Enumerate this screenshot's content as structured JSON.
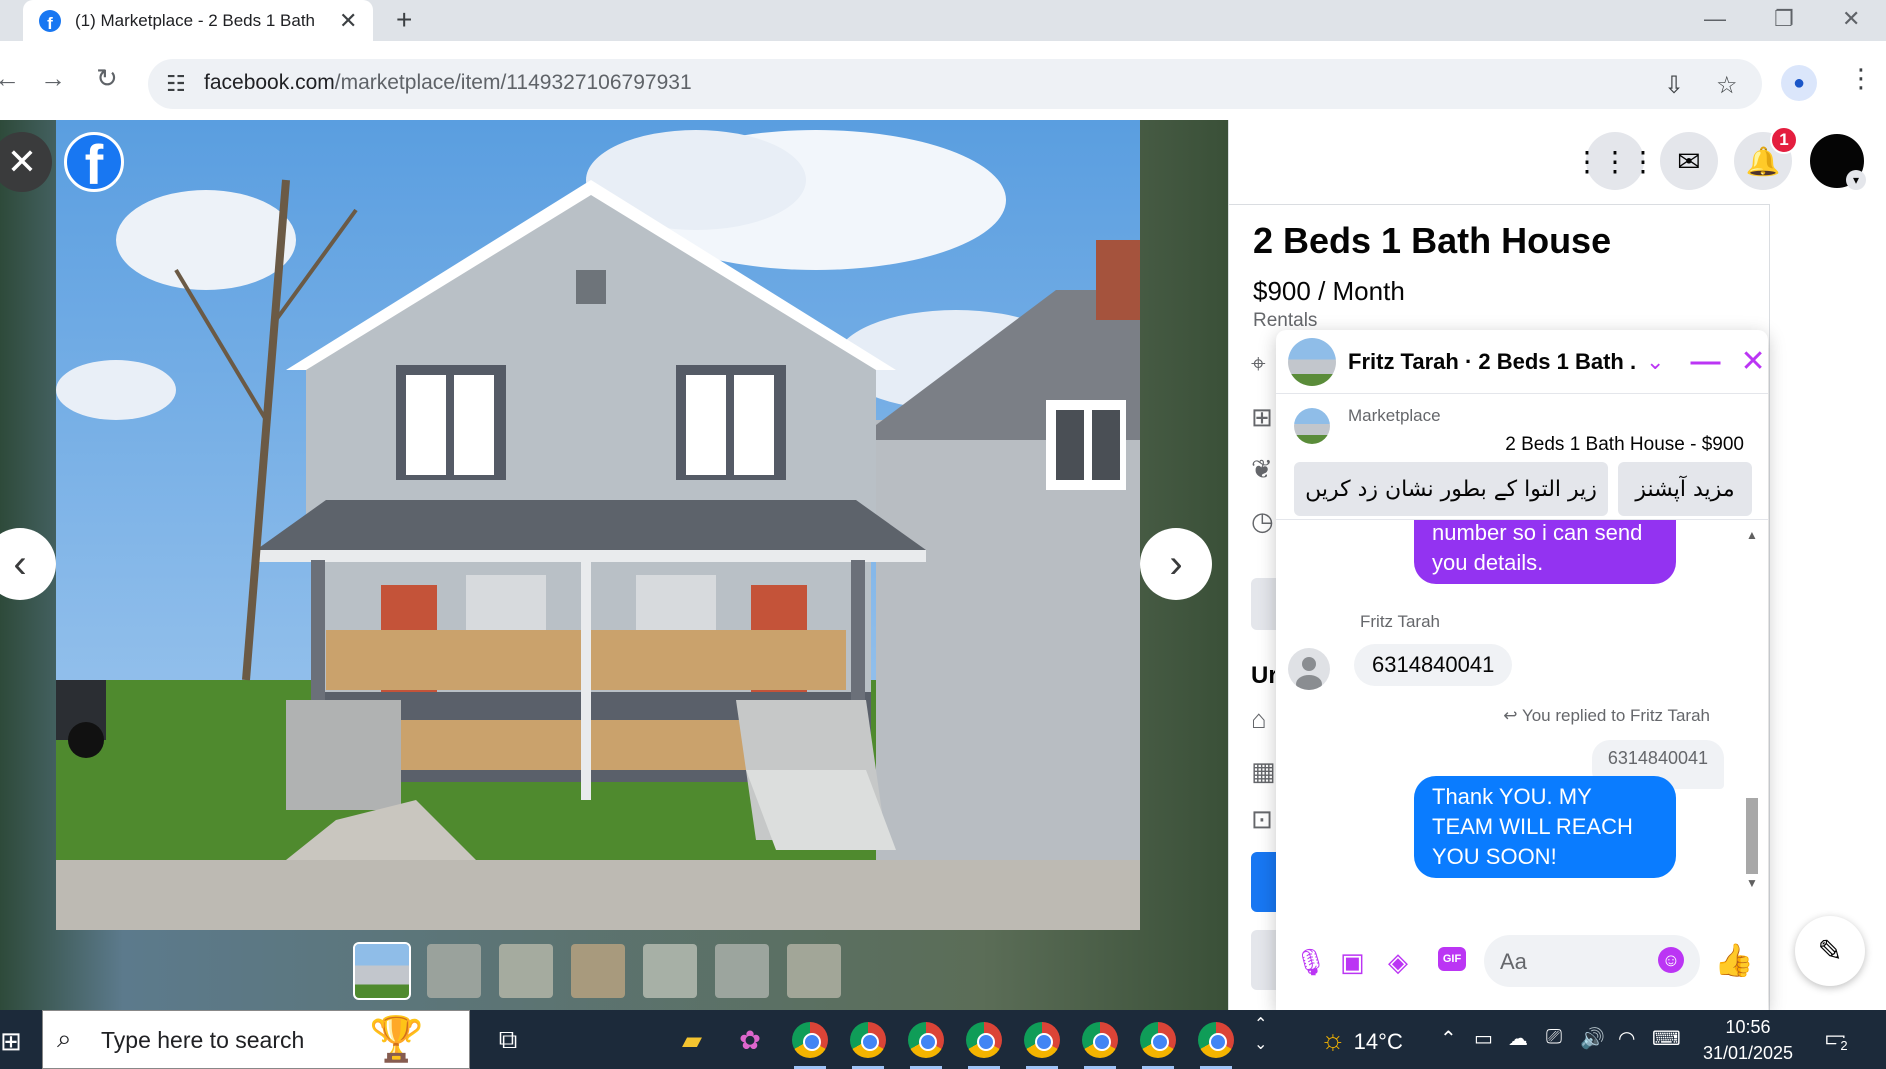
{
  "browser": {
    "tab_title": "(1) Marketplace - 2 Beds 1 Bath",
    "url_host": "facebook.com",
    "url_path": "/marketplace/item/1149327106797931"
  },
  "listing": {
    "title": "2 Beds 1 Bath House",
    "price": "$900 / Month",
    "category": "Rentals",
    "section_partial": "Ur"
  },
  "notifications": {
    "count": "1"
  },
  "chat": {
    "header_title": "Fritz Tarah · 2 Beds 1 Bath ...",
    "marketplace_label": "Marketplace",
    "item_summary": "2 Beds 1 Bath House - $900",
    "btn_mark_archived": "زیر التوا کے بطور نشان زد کریں",
    "btn_more_options": "مزید آپشنز",
    "messages": {
      "outgoing_partial": "number so i can send you details.",
      "sender_name": "Fritz Tarah",
      "incoming": "6314840041",
      "replied_label": "You replied to Fritz Tarah",
      "quoted": "6314840041",
      "outgoing_reply": "Thank YOU. MY TEAM WILL REACH YOU SOON!"
    },
    "input_placeholder": "Aa",
    "gif_label": "GIF"
  },
  "taskbar": {
    "search_placeholder": "Type here to search",
    "temperature": "14°C",
    "time": "10:56",
    "date": "31/01/2025",
    "notification_count": "2"
  },
  "colors": {
    "facebook_blue": "#1877f2",
    "messenger_purple": "#9333f1",
    "accent_violet": "#bb35f4",
    "bubble_blue": "#0a7cff",
    "badge_red": "#e41e3f"
  }
}
